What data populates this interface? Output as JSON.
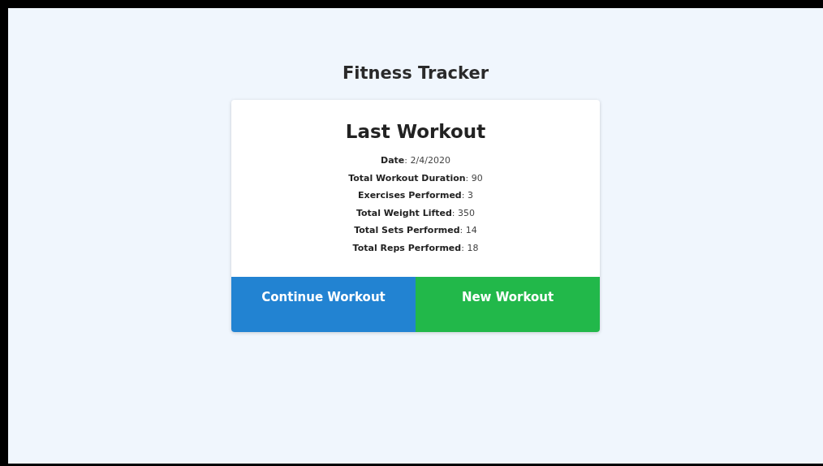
{
  "page": {
    "title": "Fitness Tracker"
  },
  "card": {
    "title": "Last Workout",
    "stats": [
      {
        "text": "**Date**: 2/4/2020"
      },
      {
        "text": "**Total Workout Duration**: 90"
      },
      {
        "text": "**Exercises Performed**: 3"
      },
      {
        "text": "**Total Weight Lifted**: 350"
      },
      {
        "text": "**Total Sets Performed**: 14"
      },
      {
        "text": "**Total Reps Performed**: 18"
      }
    ],
    "buttons": [
      {
        "label": "Continue Workout",
        "kind": "continue"
      },
      {
        "label": "New Workout",
        "kind": "new"
      }
    ]
  }
}
